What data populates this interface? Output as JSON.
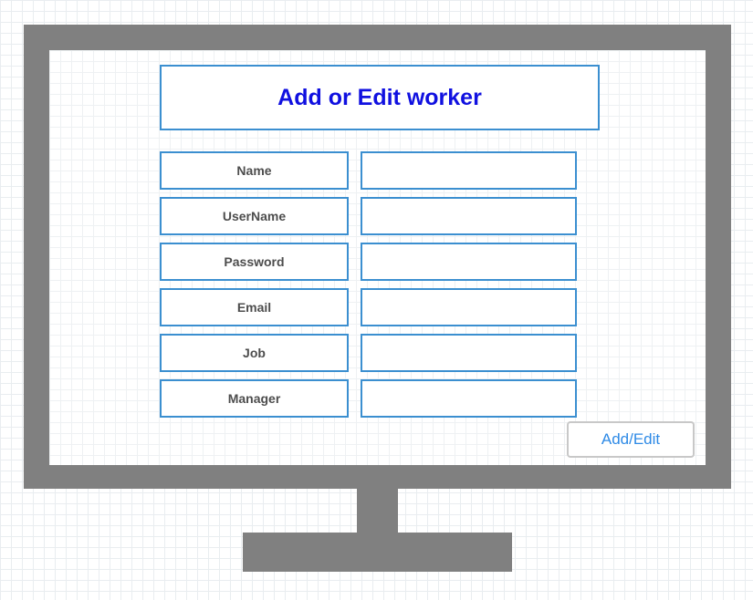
{
  "form": {
    "title": "Add or Edit worker",
    "fields": [
      {
        "label": "Name",
        "value": ""
      },
      {
        "label": "UserName",
        "value": ""
      },
      {
        "label": "Password",
        "value": ""
      },
      {
        "label": "Email",
        "value": ""
      },
      {
        "label": "Job",
        "value": ""
      },
      {
        "label": "Manager",
        "value": ""
      }
    ],
    "submit_label": "Add/Edit"
  },
  "colors": {
    "accent_border": "#3b8fd0",
    "title_text": "#1010e0",
    "button_text": "#2e8ae6",
    "monitor_frame": "#808080"
  }
}
